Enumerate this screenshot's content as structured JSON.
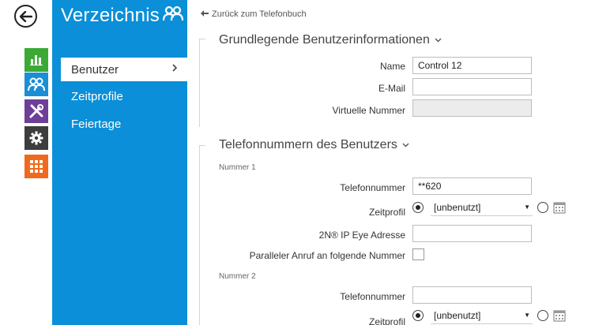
{
  "nav": {
    "title": "Verzeichnis",
    "items": [
      {
        "label": "Benutzer",
        "active": true
      },
      {
        "label": "Zeitprofile",
        "active": false
      },
      {
        "label": "Feiertage",
        "active": false
      }
    ]
  },
  "content": {
    "back_link": "Zurück zum Telefonbuch",
    "section1": {
      "title": "Grundlegende Benutzerinformationen",
      "name_label": "Name",
      "name_value": "Control 12",
      "email_label": "E-Mail",
      "email_value": "",
      "virtual_label": "Virtuelle Nummer",
      "virtual_value": ""
    },
    "section2": {
      "title": "Telefonnummern des Benutzers",
      "number1": {
        "heading": "Nummer 1",
        "phone_label": "Telefonnummer",
        "phone_value": "**620",
        "profile_label": "Zeitprofil",
        "profile_value": "[unbenutzt]",
        "ipeye_label": "2N® IP Eye Adresse",
        "ipeye_value": "",
        "parallel_label": "Paralleler Anruf an folgende Nummer"
      },
      "number2": {
        "heading": "Nummer 2",
        "phone_label": "Telefonnummer",
        "phone_value": "",
        "profile_label": "Zeitprofil",
        "profile_value": "[unbenutzt]"
      }
    }
  },
  "colors": {
    "nav_blue": "#0a8fd8",
    "green": "#3aaa35",
    "blue": "#1a8fd6",
    "purple": "#6d3f98",
    "dark": "#3d3d3d",
    "orange": "#ef6a1c"
  }
}
